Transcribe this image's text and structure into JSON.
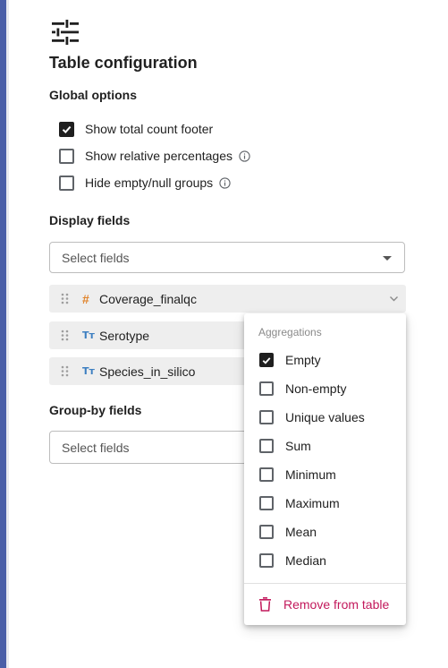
{
  "page": {
    "title": "Table configuration"
  },
  "global_options": {
    "heading": "Global options",
    "items": [
      {
        "label": "Show total count footer",
        "checked": true
      },
      {
        "label": "Show relative percentages",
        "checked": false
      },
      {
        "label": "Hide empty/null groups",
        "checked": false
      }
    ]
  },
  "display_fields": {
    "heading": "Display fields",
    "placeholder": "Select fields",
    "fields": [
      {
        "type_icon": "#",
        "name": "Coverage_finalqc"
      },
      {
        "type_icon": "Tт",
        "name": "Serotype"
      },
      {
        "type_icon": "Tт",
        "name": "Species_in_silico"
      }
    ]
  },
  "group_by": {
    "heading": "Group-by fields",
    "placeholder": "Select fields"
  },
  "aggregations_menu": {
    "header": "Aggregations",
    "items": [
      {
        "label": "Empty",
        "checked": true
      },
      {
        "label": "Non-empty",
        "checked": false
      },
      {
        "label": "Unique values",
        "checked": false
      },
      {
        "label": "Sum",
        "checked": false
      },
      {
        "label": "Minimum",
        "checked": false
      },
      {
        "label": "Maximum",
        "checked": false
      },
      {
        "label": "Mean",
        "checked": false
      },
      {
        "label": "Median",
        "checked": false
      }
    ],
    "remove_label": "Remove from table"
  },
  "colors": {
    "accent_left": "#4a5fa8",
    "number_type": "#e0832a",
    "text_type": "#3d7fc1",
    "danger": "#c2185b"
  }
}
